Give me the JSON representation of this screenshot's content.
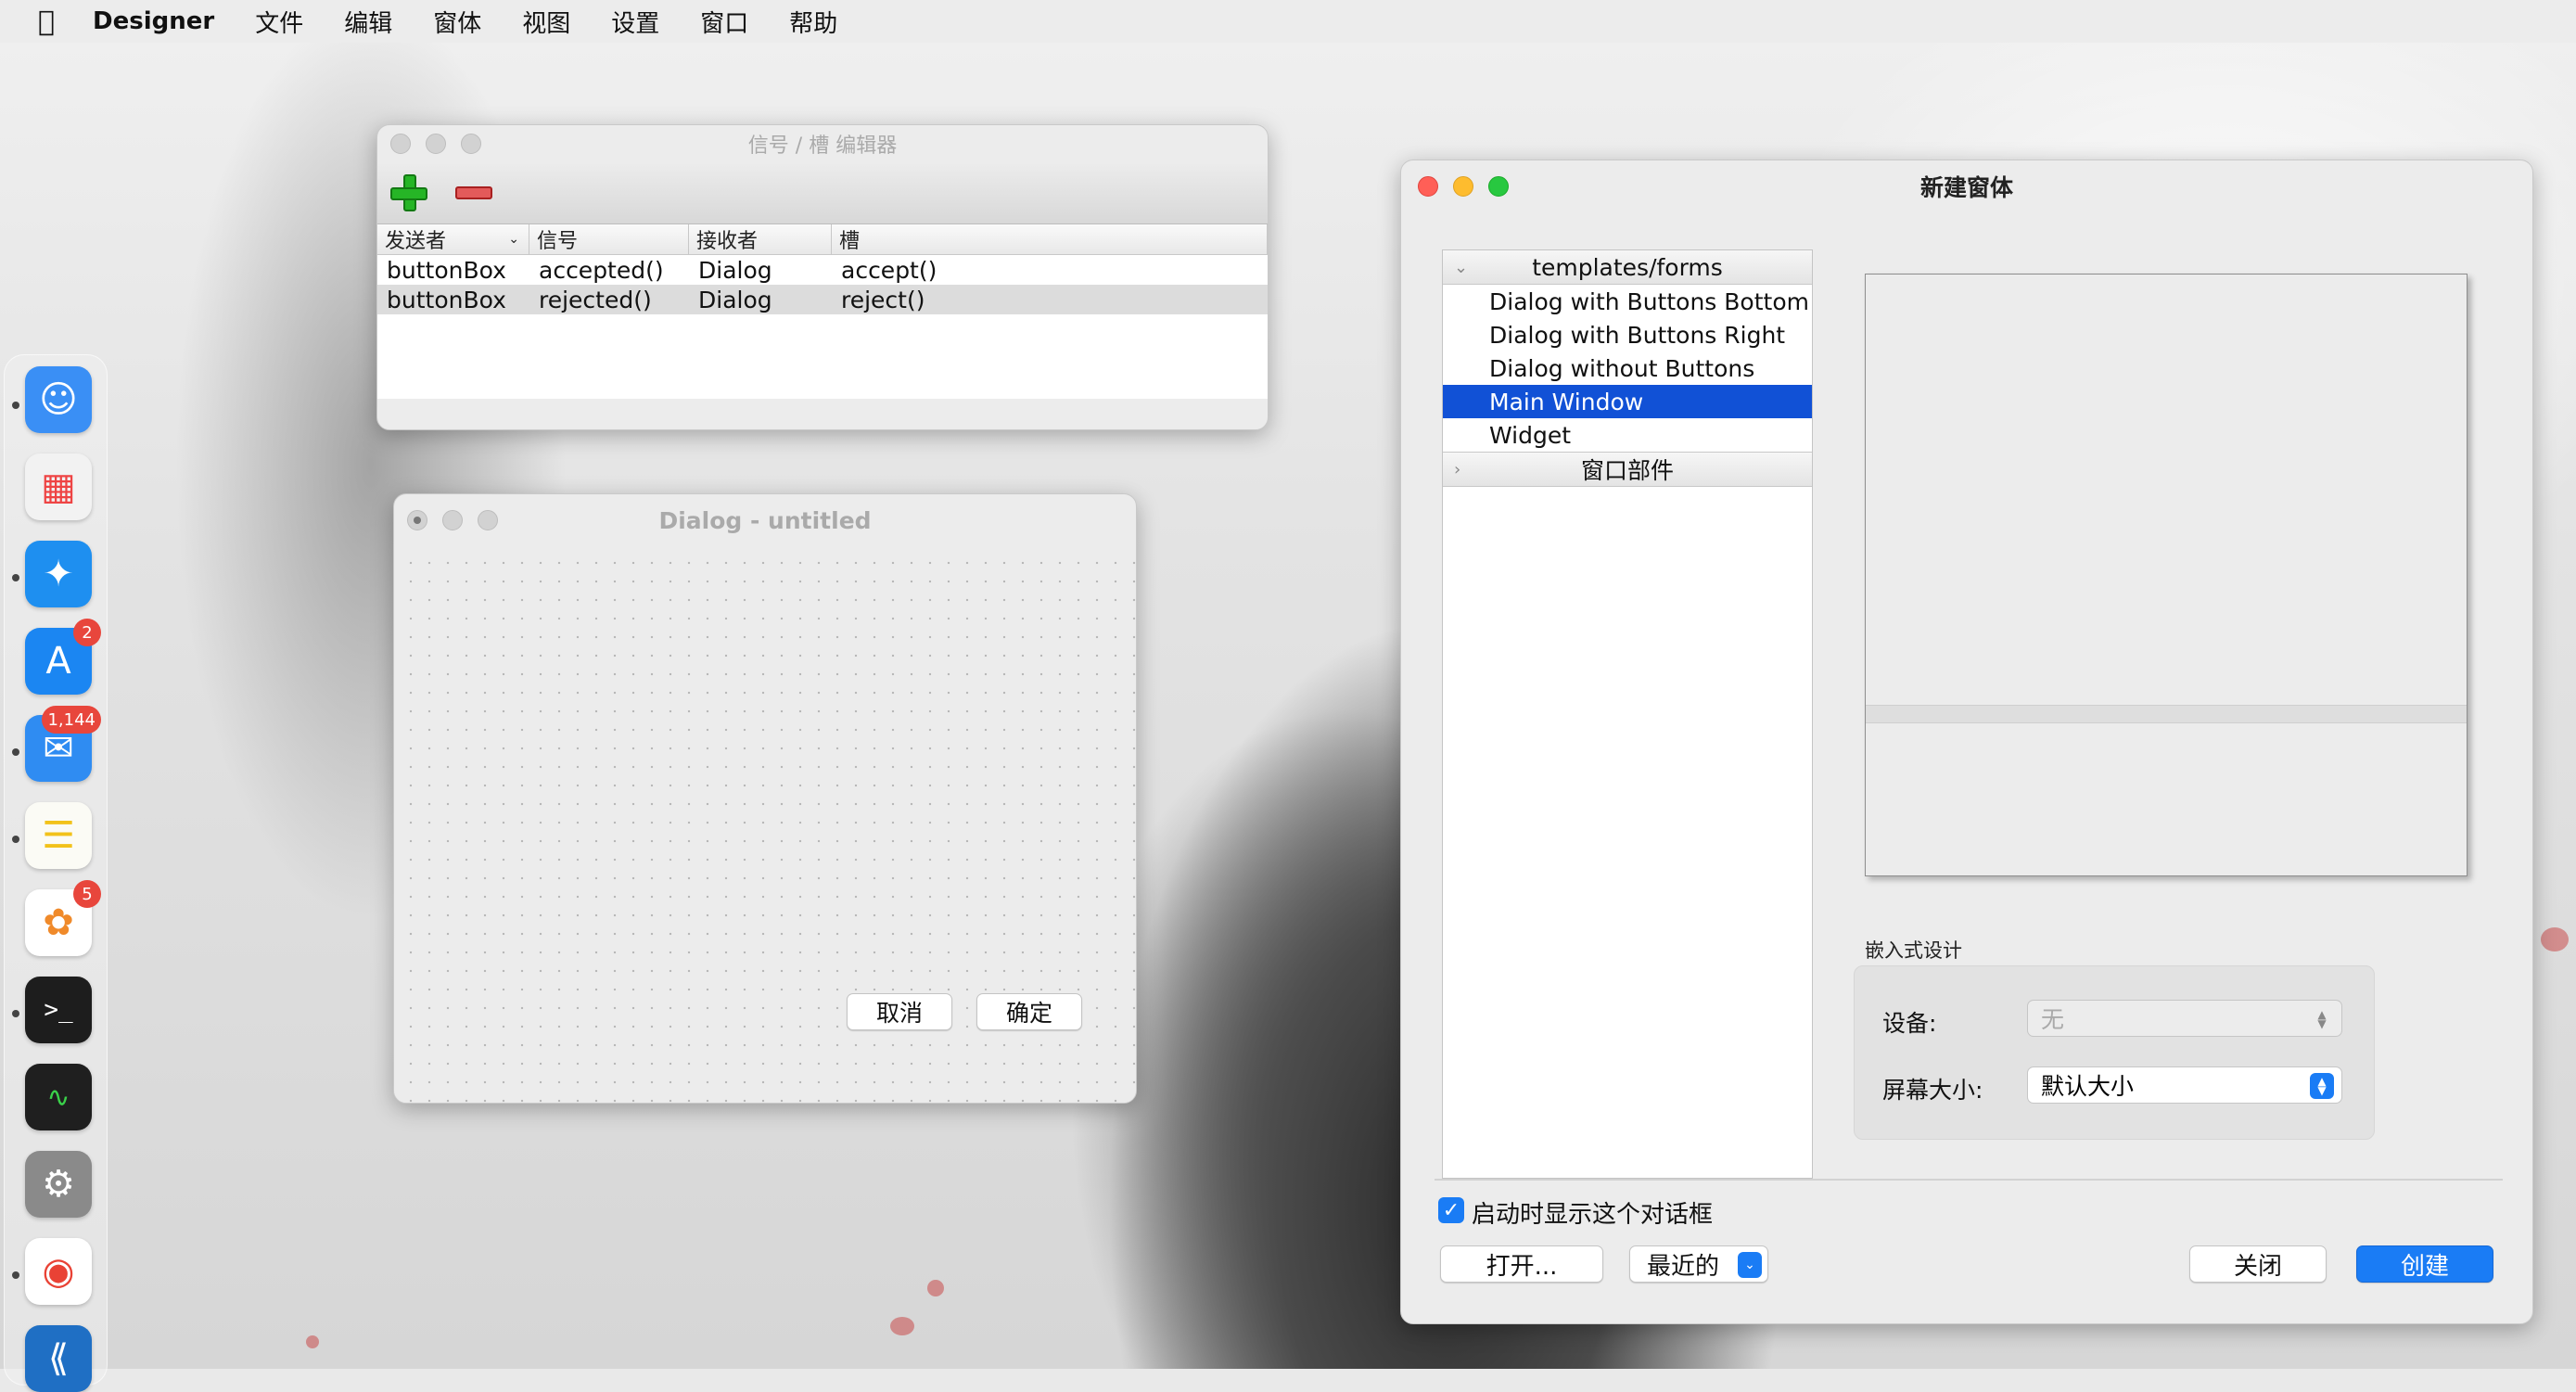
{
  "menubar": {
    "app_name": "Designer",
    "items": [
      "文件",
      "编辑",
      "窗体",
      "视图",
      "设置",
      "窗口",
      "帮助"
    ]
  },
  "dock": {
    "apps": [
      {
        "name": "Finder",
        "icon": "finder-icon",
        "color": "#3a8ff5",
        "badge": ""
      },
      {
        "name": "Launchpad",
        "icon": "launchpad-icon",
        "color": "#f2f2f2",
        "badge": ""
      },
      {
        "name": "Safari",
        "icon": "safari-icon",
        "color": "#1e8ff0",
        "badge": ""
      },
      {
        "name": "App Store",
        "icon": "app-store-icon",
        "color": "#1b86f2",
        "badge": "2"
      },
      {
        "name": "Mail",
        "icon": "mail-icon",
        "color": "#2f8cf2",
        "badge": "1,144"
      },
      {
        "name": "Notes",
        "icon": "notes-icon",
        "color": "#fbfbf5",
        "badge": ""
      },
      {
        "name": "Photos",
        "icon": "photos-icon",
        "color": "#ffffff",
        "badge": "5"
      },
      {
        "name": "Terminal",
        "icon": "terminal-icon",
        "color": "#1d1d1d",
        "badge": ""
      },
      {
        "name": "Activity Monitor",
        "icon": "activity-monitor-icon",
        "color": "#1f1f1f",
        "badge": ""
      },
      {
        "name": "System Settings",
        "icon": "settings-gear-icon",
        "color": "#8a8a8a",
        "badge": ""
      },
      {
        "name": "Chrome",
        "icon": "chrome-icon",
        "color": "#ffffff",
        "badge": ""
      },
      {
        "name": "VS Code",
        "icon": "vscode-icon",
        "color": "#1f6fc4",
        "badge": ""
      }
    ]
  },
  "signal_slot_editor": {
    "title": "信号 / 槽 编辑器",
    "columns": [
      "发送者",
      "信号",
      "接收者",
      "槽"
    ],
    "rows": [
      {
        "sender": "buttonBox",
        "signal": "accepted()",
        "receiver": "Dialog",
        "slot": "accept()"
      },
      {
        "sender": "buttonBox",
        "signal": "rejected()",
        "receiver": "Dialog",
        "slot": "reject()"
      }
    ]
  },
  "dialog_preview": {
    "title": "Dialog - untitled",
    "cancel_label": "取消",
    "ok_label": "确定"
  },
  "new_form": {
    "title": "新建窗体",
    "categories": [
      {
        "label": "templates/forms",
        "items": [
          {
            "label": "Dialog with Buttons Bottom",
            "selected": false
          },
          {
            "label": "Dialog with Buttons Right",
            "selected": false
          },
          {
            "label": "Dialog without Buttons",
            "selected": false
          },
          {
            "label": "Main Window",
            "selected": true
          },
          {
            "label": "Widget",
            "selected": false
          }
        ]
      },
      {
        "label": "窗口部件",
        "items": []
      }
    ],
    "embedded": {
      "section_label": "嵌入式设计",
      "device_label": "设备:",
      "device_value": "无",
      "screen_label": "屏幕大小:",
      "screen_value": "默认大小"
    },
    "show_on_startup": {
      "label": "启动时显示这个对话框",
      "checked": true
    },
    "buttons": {
      "open": "打开...",
      "recent": "最近的",
      "close": "关闭",
      "create": "创建"
    }
  }
}
